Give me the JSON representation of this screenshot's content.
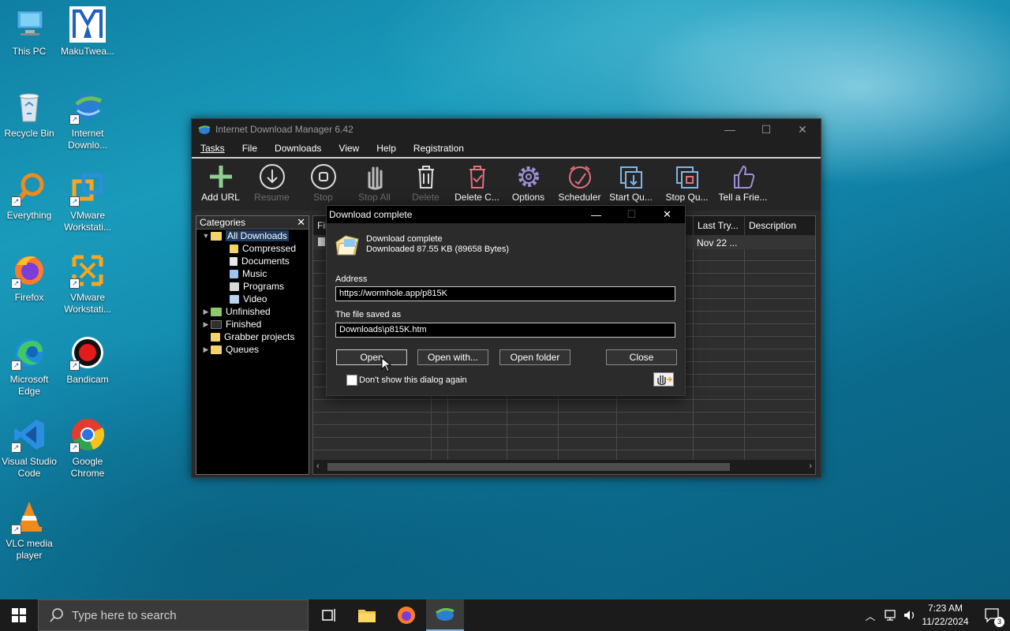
{
  "desktop": {
    "icons": [
      {
        "label": "This PC"
      },
      {
        "label": "MakuTwea..."
      },
      {
        "label": "Recycle Bin"
      },
      {
        "label": "Internet Downlo..."
      },
      {
        "label": "Everything"
      },
      {
        "label": "VMware Workstati..."
      },
      {
        "label": "Firefox"
      },
      {
        "label": "VMware Workstati..."
      },
      {
        "label": "Microsoft Edge"
      },
      {
        "label": "Bandicam"
      },
      {
        "label": "Visual Studio Code"
      },
      {
        "label": "Google Chrome"
      },
      {
        "label": "VLC media player"
      }
    ]
  },
  "idm": {
    "title": "Internet Download Manager 6.42",
    "menu": [
      "Tasks",
      "File",
      "Downloads",
      "View",
      "Help",
      "Registration"
    ],
    "toolbar": [
      {
        "label": "Add URL",
        "icon": "plus-icon"
      },
      {
        "label": "Resume",
        "icon": "resume-icon"
      },
      {
        "label": "Stop",
        "icon": "stop-icon"
      },
      {
        "label": "Stop All",
        "icon": "hand-icon"
      },
      {
        "label": "Delete",
        "icon": "trash-icon"
      },
      {
        "label": "Delete C...",
        "icon": "delete-completed-icon"
      },
      {
        "label": "Options",
        "icon": "gear-icon"
      },
      {
        "label": "Scheduler",
        "icon": "clock-icon"
      },
      {
        "label": "Start Qu...",
        "icon": "start-queue-icon"
      },
      {
        "label": "Stop Qu...",
        "icon": "stop-queue-icon"
      },
      {
        "label": "Tell a Frie...",
        "icon": "thumbs-up-icon"
      }
    ],
    "categories": {
      "header": "Categories",
      "close": "✕",
      "items": [
        {
          "label": "All Downloads"
        },
        {
          "label": "Compressed"
        },
        {
          "label": "Documents"
        },
        {
          "label": "Music"
        },
        {
          "label": "Programs"
        },
        {
          "label": "Video"
        },
        {
          "label": "Unfinished"
        },
        {
          "label": "Finished"
        },
        {
          "label": "Grabber projects"
        },
        {
          "label": "Queues"
        }
      ]
    },
    "list": {
      "col_file": "Fil",
      "col_last_try": "Last Try...",
      "col_description": "Description",
      "row_last_try": "Nov 22 ..."
    }
  },
  "dialog": {
    "title": "Download complete",
    "heading": "Download complete",
    "downloaded": "Downloaded 87.55  KB (89658 Bytes)",
    "address_label": "Address",
    "address_value": "https://wormhole.app/p815K",
    "saved_label": "The file saved as",
    "saved_value": "Downloads\\p815K.htm",
    "open": "Open",
    "open_with": "Open with...",
    "open_folder": "Open folder",
    "close": "Close",
    "dont_show": "Don't show this dialog again"
  },
  "taskbar": {
    "search_placeholder": "Type here to search",
    "time": "7:23 AM",
    "date": "11/22/2024",
    "notification_count": "3"
  }
}
